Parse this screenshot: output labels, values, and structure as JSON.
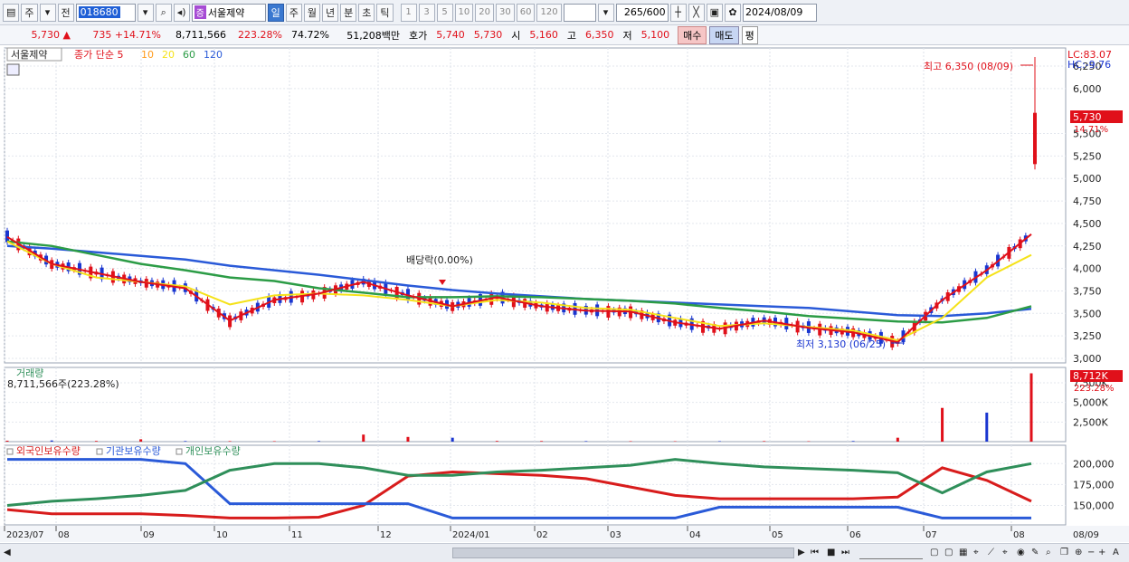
{
  "toolbar": {
    "type_label": "주",
    "prev_label": "전",
    "code": "018680",
    "badge": "증",
    "name": "서울제약",
    "periods": [
      {
        "label": "일",
        "selected": true
      },
      {
        "label": "주",
        "selected": false
      },
      {
        "label": "월",
        "selected": false
      },
      {
        "label": "년",
        "selected": false
      },
      {
        "label": "분",
        "selected": false
      },
      {
        "label": "초",
        "selected": false
      },
      {
        "label": "틱",
        "selected": false
      }
    ],
    "intervals": [
      "1",
      "3",
      "5",
      "10",
      "20",
      "30",
      "60",
      "120"
    ],
    "count_current": "265",
    "count_total": "/600",
    "date": "2024/08/09"
  },
  "quote": {
    "price": "5,730 ▲",
    "change": "735 +14.71%",
    "volume": "8,711,566",
    "volume_ratio": "223.28%",
    "turnover": "74.72%",
    "amount": "51,208백만",
    "bid_label": "호가",
    "bid": "5,740",
    "ask": "5,730",
    "open_label": "시",
    "open": "5,160",
    "high_label": "고",
    "high": "6,350",
    "low_label": "저",
    "low": "5,100",
    "buy_label": "매수",
    "sell_label": "매도",
    "pyeong_label": "평"
  },
  "chart_labels": {
    "stock_name": "서울제약",
    "ma_title": "종가 단순 5",
    "ma_periods": [
      "10",
      "20",
      "60",
      "120"
    ],
    "lc": "LC:83.07",
    "hc": "HC:-9.76",
    "high_note": "최고 6,350 (08/09)",
    "low_note": "최저 3,130 (06/25)",
    "dividend_note": "배당락(0.00%)",
    "last_price": "5,730",
    "last_pct": "14.71%",
    "volume_title": "거래량",
    "volume_value": "8,711,566주(223.28%)",
    "volume_last": "8,712K",
    "volume_pct": "223.28%",
    "holding_titles": [
      "외국인보유수량",
      "기관보유수량",
      "개인보유수량"
    ],
    "x_axis_end": "08/09"
  },
  "colors": {
    "up": "#e0101a",
    "down": "#1a36d0",
    "ma5": "#e0101a",
    "ma10": "#ff9a1a",
    "ma20": "#f5e21a",
    "ma60": "#2c9c46",
    "ma120": "#2a5ad8",
    "foreign": "#d81c1c",
    "institution": "#2a5ad8",
    "individual": "#2f8f5a"
  },
  "chart_data": [
    {
      "type": "line",
      "title": "서울제약 일봉",
      "x_ticks": [
        "2023/07",
        "08",
        "09",
        "10",
        "11",
        "12",
        "2024/01",
        "02",
        "03",
        "04",
        "05",
        "06",
        "07",
        "08"
      ],
      "y_ticks": [
        "3,000",
        "3,250",
        "3,500",
        "3,750",
        "4,000",
        "4,250",
        "4,500",
        "4,750",
        "5,000",
        "5,250",
        "5,500",
        "6,000",
        "6,250"
      ],
      "ylim": [
        3000,
        6250
      ],
      "series": [
        {
          "name": "MA120",
          "values": [
            4250,
            4220,
            4180,
            4140,
            4100,
            4030,
            3980,
            3930,
            3870,
            3810,
            3760,
            3720,
            3690,
            3660,
            3640,
            3620,
            3600,
            3580,
            3560,
            3520,
            3480,
            3470,
            3500,
            3550
          ]
        },
        {
          "name": "MA60",
          "values": [
            4300,
            4250,
            4150,
            4050,
            3980,
            3900,
            3860,
            3780,
            3730,
            3680,
            3680,
            3690,
            3680,
            3660,
            3640,
            3610,
            3560,
            3520,
            3470,
            3440,
            3410,
            3400,
            3450,
            3580
          ]
        },
        {
          "name": "MA20",
          "values": [
            4300,
            4050,
            3900,
            3850,
            3800,
            3600,
            3700,
            3720,
            3700,
            3650,
            3580,
            3650,
            3620,
            3560,
            3540,
            3450,
            3360,
            3390,
            3350,
            3310,
            3200,
            3450,
            3900,
            4150
          ]
        },
        {
          "name": "MA5",
          "values": [
            4350,
            4050,
            3950,
            3850,
            3780,
            3420,
            3650,
            3720,
            3850,
            3700,
            3580,
            3680,
            3580,
            3530,
            3520,
            3400,
            3330,
            3420,
            3340,
            3290,
            3180,
            3650,
            3980,
            4380
          ]
        }
      ]
    },
    {
      "type": "bar",
      "title": "거래량",
      "y_ticks": [
        "2,500K",
        "5,000K",
        "7,500K"
      ],
      "ylim": [
        0,
        9000
      ],
      "values": [
        120,
        150,
        90,
        300,
        80,
        70,
        60,
        80,
        900,
        600,
        500,
        90,
        80,
        70,
        60,
        50,
        60,
        70,
        50,
        80,
        500,
        4300,
        3700,
        8712
      ]
    },
    {
      "type": "line",
      "title": "보유수량",
      "y_ticks": [
        "150,000",
        "175,000",
        "200,000"
      ],
      "ylim": [
        130000,
        210000
      ],
      "series": [
        {
          "name": "외국인보유수량",
          "values": [
            145000,
            140000,
            140000,
            140000,
            138000,
            135000,
            135000,
            136000,
            150000,
            185000,
            190000,
            188000,
            186000,
            182000,
            172000,
            162000,
            158000,
            158000,
            158000,
            158000,
            160000,
            195000,
            180000,
            155000
          ]
        },
        {
          "name": "기관보유수량",
          "values": [
            205000,
            205000,
            205000,
            205000,
            200000,
            152000,
            152000,
            152000,
            152000,
            152000,
            135000,
            135000,
            135000,
            135000,
            135000,
            135000,
            148000,
            148000,
            148000,
            148000,
            148000,
            135000,
            135000,
            135000
          ]
        },
        {
          "name": "개인보유수량",
          "values": [
            150000,
            155000,
            158000,
            162000,
            168000,
            192000,
            200000,
            200000,
            195000,
            186000,
            186000,
            190000,
            192000,
            195000,
            198000,
            205000,
            200000,
            196000,
            194000,
            192000,
            189000,
            165000,
            190000,
            200000
          ]
        }
      ]
    }
  ]
}
